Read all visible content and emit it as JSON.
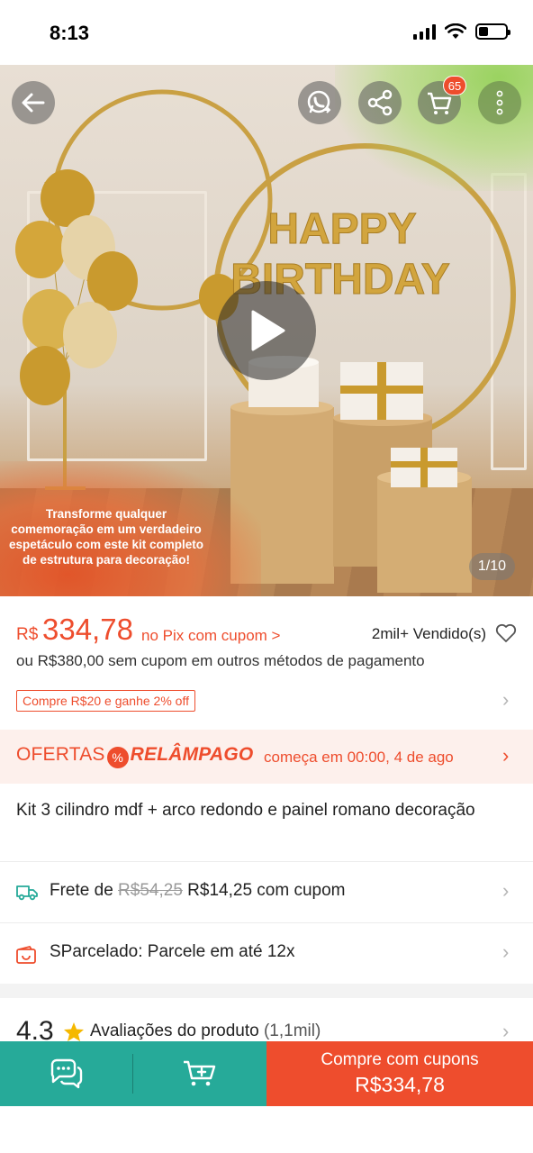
{
  "status_bar": {
    "time": "8:13",
    "battery_level": 0.35
  },
  "hero": {
    "promo_text": "Transforme qualquer comemoração em um verdadeiro espetáculo com este kit completo de estrutura para decoração!",
    "image_text": "HAPPY BIRTHDAY",
    "page_indicator": "1/10",
    "cart_count": "65"
  },
  "price": {
    "currency": "R$",
    "value": "334,78",
    "note": "no Pix com cupom >",
    "sold": "2mil+ Vendido(s)",
    "alt_price": "ou R$380,00 sem cupom em outros métodos de pagamento",
    "voucher": "Compre R$20 e ganhe 2% off"
  },
  "flash_sale": {
    "title_part1": "OFERTAS",
    "title_part2": "RELÂMPAGO",
    "time_text": "começa em 00:00, 4 de ago"
  },
  "product": {
    "title": "Kit 3 cilindro mdf + arco redondo e painel romano decoração"
  },
  "shipping": {
    "prefix": "Frete de",
    "old_price": "R$54,25",
    "new_price": "R$14,25 com cupom"
  },
  "installments": {
    "text": "SParcelado: Parcele em até 12x"
  },
  "rating": {
    "score": "4.3",
    "label": "Avaliações do produto",
    "count": "(1,1mil)"
  },
  "bottom_bar": {
    "buy_label": "Compre com cupons",
    "buy_price": "R$334,78"
  },
  "colors": {
    "accent": "#ee4d2d",
    "teal": "#26aa99",
    "flash_bg": "#fdf0ec"
  }
}
